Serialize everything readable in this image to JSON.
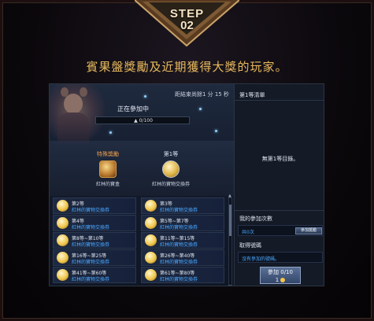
{
  "step": {
    "label": "STEP",
    "number": "02"
  },
  "headline": "賓果盤獎勵及近期獲得大獎的玩家。",
  "game": {
    "countdown": "距結束尚餘1 分 15 秒",
    "participating": "正在參加中",
    "progress": {
      "text": "0/100",
      "value": 0,
      "max": 100
    },
    "featured": {
      "special": {
        "title": "特殊獎勵",
        "name": "紅林的寶盒"
      },
      "first": {
        "title": "第1等",
        "name": "紅林的寶物交換券"
      }
    },
    "rewards": [
      {
        "rank": "第2等",
        "item": "紅林的寶物交換券"
      },
      {
        "rank": "第3等",
        "item": "紅林的寶物交換券"
      },
      {
        "rank": "第4等",
        "item": "紅林的寶物交換券"
      },
      {
        "rank": "第5等~第7等",
        "item": "紅林的寶物交換券"
      },
      {
        "rank": "第8等~第10等",
        "item": "紅林的寶物交換券"
      },
      {
        "rank": "第11等~第15等",
        "item": "紅林的寶物交換券"
      },
      {
        "rank": "第16等~第25等",
        "item": "紅林的寶物交換券"
      },
      {
        "rank": "第26等~第40等",
        "item": "紅林的寶物交換券"
      },
      {
        "rank": "第41等~第60等",
        "item": "紅林的寶物交換券"
      },
      {
        "rank": "第61等~第80等",
        "item": "紅林的寶物交換券"
      }
    ],
    "right_panel": {
      "title": "第1等清單",
      "empty_text": "無第1等目錄。",
      "my_entries_label": "我的參加次數",
      "my_entries_value": "共0次",
      "participate_button": "參加獎勵",
      "ticket_label": "取得號碼",
      "ticket_empty": "沒有參加的號碼。",
      "join_label": "參加 0/10",
      "join_cost": "1"
    }
  },
  "colors": {
    "accent": "#e8b95c",
    "link": "#4aa8ff",
    "special": "#f0a04c"
  }
}
